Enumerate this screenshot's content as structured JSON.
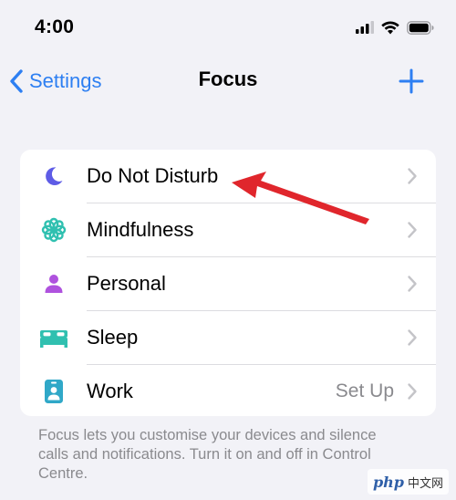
{
  "status_bar": {
    "time": "4:00"
  },
  "nav": {
    "back_label": "Settings",
    "title": "Focus"
  },
  "focus_list": [
    {
      "label": "Do Not Disturb",
      "value": "",
      "icon": "moon-icon",
      "icon_color": "#5e5ce6"
    },
    {
      "label": "Mindfulness",
      "value": "",
      "icon": "flower-icon",
      "icon_color": "#30c0b0"
    },
    {
      "label": "Personal",
      "value": "",
      "icon": "person-icon",
      "icon_color": "#af52de"
    },
    {
      "label": "Sleep",
      "value": "",
      "icon": "bed-icon",
      "icon_color": "#30c0b0"
    },
    {
      "label": "Work",
      "value": "Set Up",
      "icon": "id-badge-icon",
      "icon_color": "#30a8c8"
    }
  ],
  "footer": {
    "text": "Focus lets you customise your devices and silence calls and notifications. Turn it on and off in Control Centre."
  },
  "watermark": {
    "logo": "php",
    "text": "中文网"
  },
  "colors": {
    "accent": "#2d7ff2",
    "annotation": "#e0262c",
    "background": "#f2f2f7"
  }
}
